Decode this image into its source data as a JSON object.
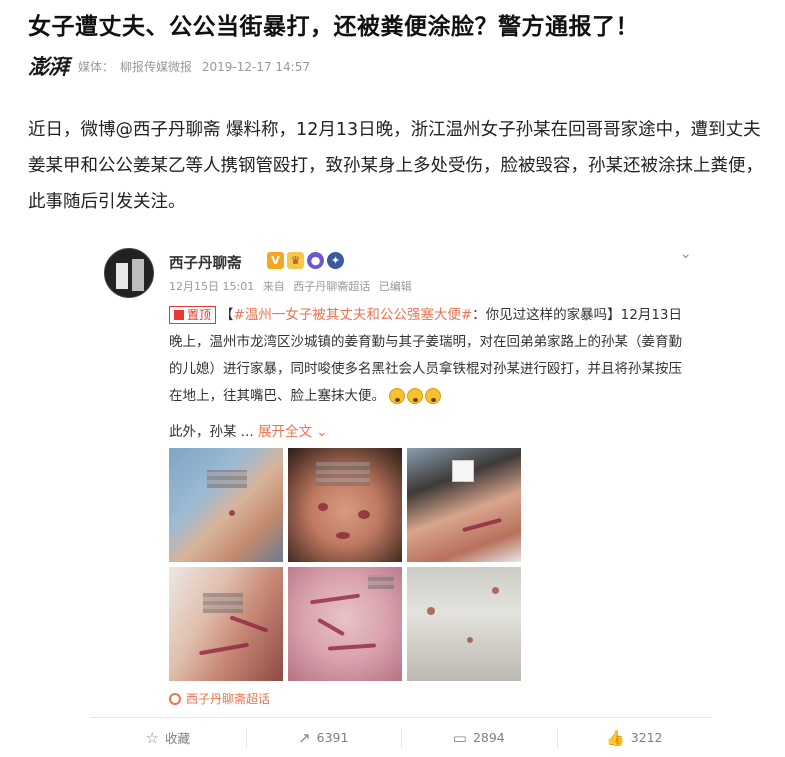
{
  "article": {
    "headline": "女子遭丈夫、公公当街暴打，还被粪便涂脸？警方通报了！",
    "logo_text": "澎湃",
    "media_label": "媒体：",
    "source": "柳报传媒微报",
    "timestamp": "2019-12-17 14:57",
    "lead": "近日，微博@西子丹聊斋 爆料称，12月13日晚，浙江温州女子孙某在回哥哥家途中，遭到丈夫姜某甲和公公姜某乙等人携钢管殴打，致孙某身上多处受伤，脸被毁容，孙某还被涂抹上粪便，此事随后引发关注。"
  },
  "weibo": {
    "username": "西子丹聊斋",
    "badge_v": "V",
    "date": "12月15日 15:01",
    "from_label": "来自",
    "from_source": "西子丹聊斋超话",
    "edited": "已编辑",
    "pinned_label": "置顶",
    "bracket_open": "【",
    "topic": "#温州一女子被其丈夫和公公强塞大便#",
    "post_head": "：你见过这样的家暴吗】12月13日晚上，温州市龙湾区沙城镇的姜育勤与其子姜瑞明，对在回弟弟家路上的孙某（姜育勤的儿媳）进行家暴，同时唆使多名黑社会人员拿铁棍对孙某进行殴打，并且将孙某按压在地上，往其嘴巴、脸上塞抹大便。",
    "more_text": "此外，孙某 ...",
    "expand_label": "展开全文",
    "supertopic_label": "西子丹聊斋超话",
    "footer": {
      "favorite_label": "收藏",
      "repost_count": "6391",
      "comment_count": "2894",
      "like_count": "3212"
    }
  },
  "colors": {
    "accent": "#eb7350",
    "pin_red": "#e8382f",
    "meta_gray": "#999999"
  },
  "icons": [
    "chevron-down-icon",
    "star-icon",
    "repost-icon",
    "comment-icon",
    "like-icon",
    "supertopic-icon",
    "pin-icon"
  ]
}
